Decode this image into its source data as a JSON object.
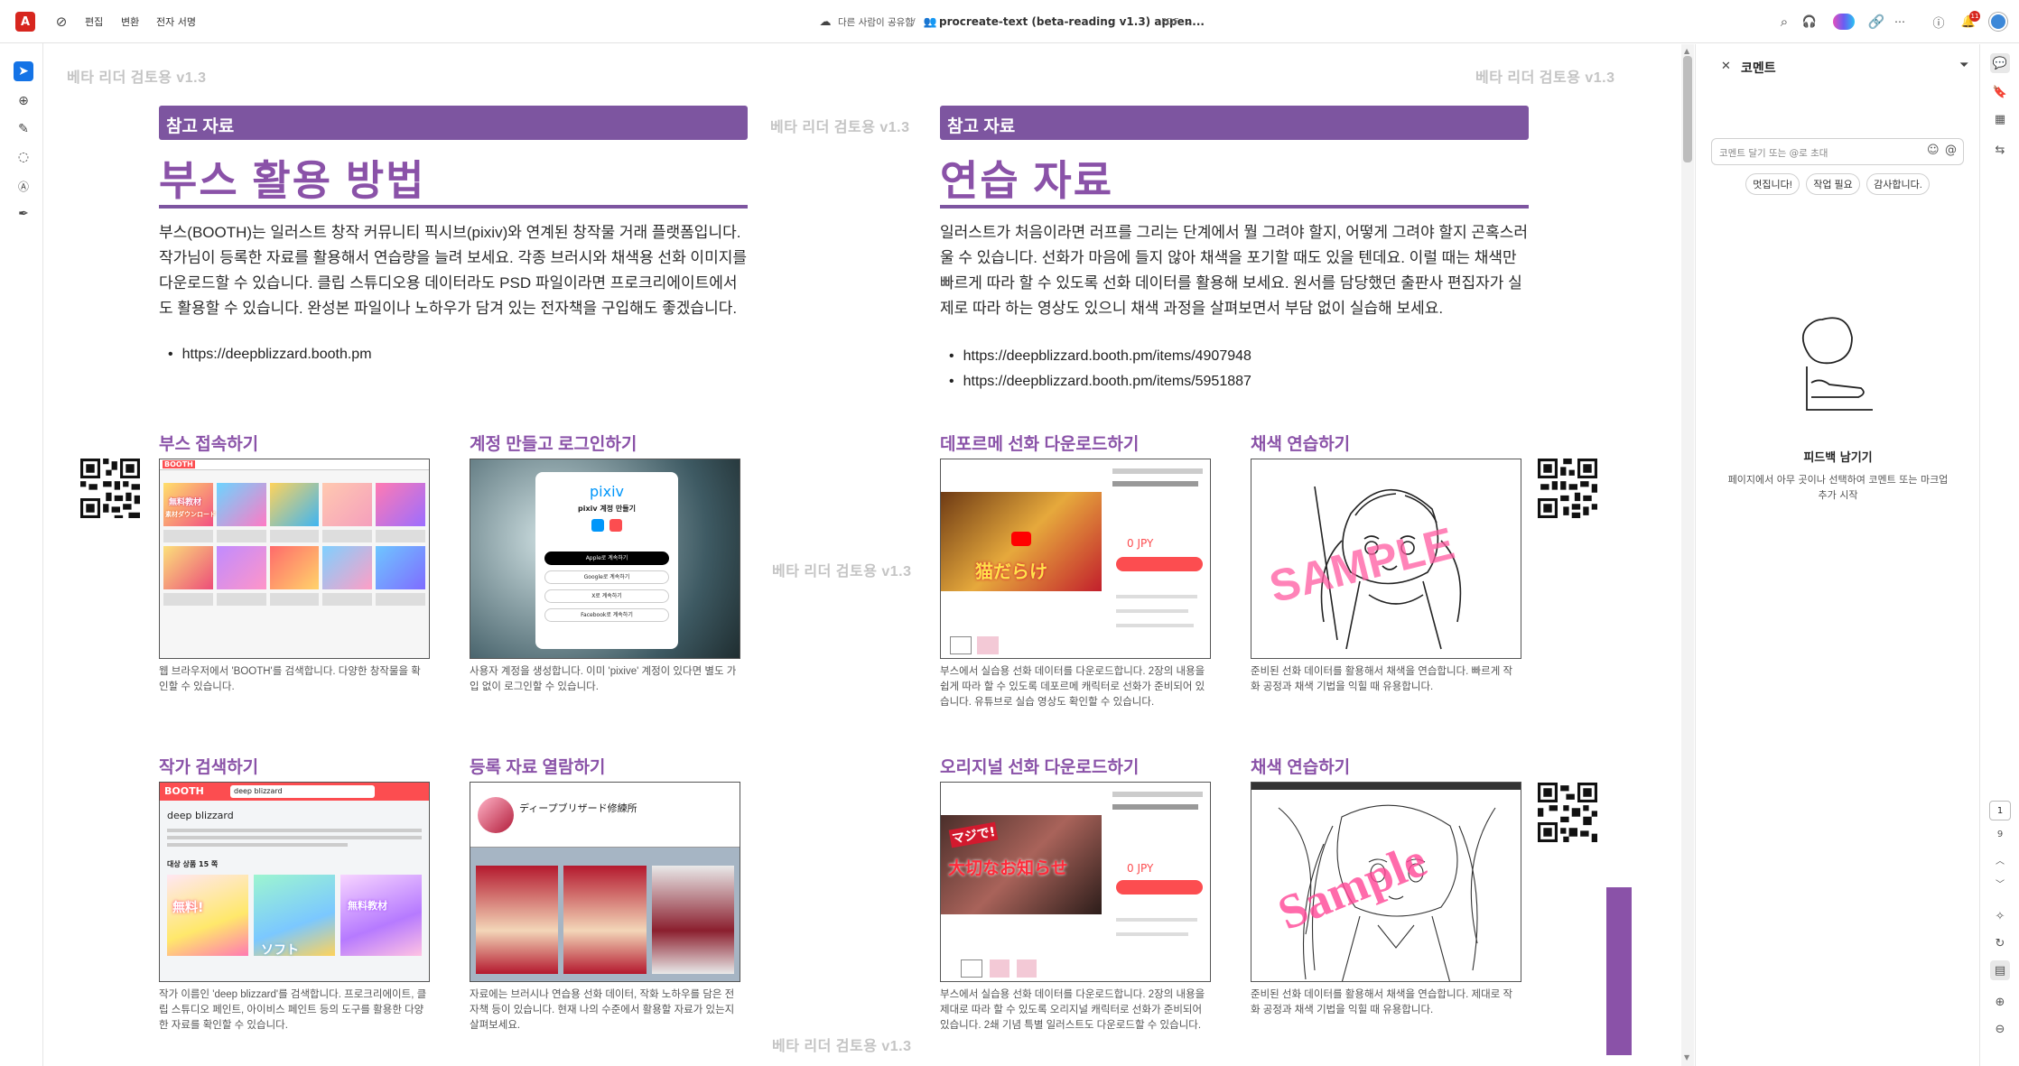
{
  "topbar": {
    "logo": "A",
    "menu": [
      "편집",
      "변환",
      "전자 서명"
    ],
    "share_status": "다른 사람이 공유함",
    "separator": "/",
    "doc_title": "procreate-text (beta-reading v1.3) appen...",
    "doc_type": "PDF",
    "notification_count": "11"
  },
  "page": {
    "watermark": "베타 리더 검토용 v1.3",
    "left": {
      "band": "참고 자료",
      "heading": "부스 활용 방법",
      "body": "부스(BOOTH)는 일러스트 창작 커뮤니티 픽시브(pixiv)와 연계된 창작물 거래 플랫폼입니다. 작가님이 등록한 자료를 활용해서 연습량을 늘려 보세요. 각종 브러시와 채색용 선화 이미지를 다운로드할 수 있습니다. 클립 스튜디오용 데이터라도 PSD 파일이라면 프로크리에이트에서도 활용할 수 있습니다. 완성본 파일이나 노하우가 담겨 있는 전자책을 구입해도 좋겠습니다.",
      "links": [
        "https://deepblizzard.booth.pm"
      ],
      "sections": [
        {
          "title": "부스 접속하기",
          "caption": "웹 브라우저에서 'BOOTH'를 검색합니다. 다양한 창작물을 확인할 수 있습니다."
        },
        {
          "title": "계정 만들고 로그인하기",
          "caption": "사용자 계정을 생성합니다. 이미 'pixive' 계정이 있다면 별도 가입 없이 로그인할 수 있습니다."
        },
        {
          "title": "작가 검색하기",
          "caption": "작가 이름인 'deep blizzard'를 검색합니다. 프로크리에이트, 클립 스튜디오 페인트, 아이비스 페인트 등의 도구를 활용한 다양한 자료를 확인할 수 있습니다."
        },
        {
          "title": "등록 자료 열람하기",
          "caption": "자료에는 브러시나 연습용 선화 데이터, 작화 노하우를 담은 전자책 등이 있습니다. 현재 나의 수준에서 활용할 자료가 있는지 살펴보세요."
        }
      ]
    },
    "right": {
      "band": "참고 자료",
      "heading": "연습 자료",
      "body": "일러스트가 처음이라면 러프를 그리는 단계에서 뭘 그려야 할지, 어떻게 그려야 할지 곤혹스러울 수 있습니다. 선화가 마음에 들지 않아 채색을 포기할 때도 있을 텐데요. 이럴 때는 채색만 빠르게 따라 할 수 있도록 선화 데이터를 활용해 보세요. 원서를 담당했던 출판사 편집자가 실제로 따라 하는 영상도 있으니 채색 과정을 살펴보면서 부담 없이 실습해 보세요.",
      "links": [
        "https://deepblizzard.booth.pm/items/4907948",
        "https://deepblizzard.booth.pm/items/5951887"
      ],
      "sections": [
        {
          "title": "데포르메 선화 다운로드하기",
          "caption": "부스에서 실습용 선화 데이터를 다운로드합니다. 2장의 내용을 쉽게 따라 할 수 있도록 데포르메 캐릭터로 선화가 준비되어 있습니다. 유튜브로 실습 영상도 확인할 수 있습니다."
        },
        {
          "title": "채색 연습하기",
          "caption": "준비된 선화 데이터를 활용해서 채색을 연습합니다. 빠르게 작화 공정과 채색 기법을 익힐 때 유용합니다."
        },
        {
          "title": "오리지널 선화 다운로드하기",
          "caption": "부스에서 실습용 선화 데이터를 다운로드합니다. 2장의 내용을 제대로 따라 할 수 있도록 오리지널 캐릭터로 선화가 준비되어 있습니다. 2쇄 기념 특별 일러스트도 다운로드할 수 있습니다."
        },
        {
          "title": "채색 연습하기",
          "caption": "준비된 선화 데이터를 활용해서 채색을 연습합니다. 제대로 작화 공정과 채색 기법을 익힐 때 유용합니다."
        }
      ]
    },
    "thumbs": {
      "booth_tab": "BOOTH",
      "booth_search": "deep blizzard",
      "booth_user": "deep blizzard",
      "booth_count": "대상 상품 15 쪽",
      "pixiv_logo": "pixiv",
      "pixiv_title": "pixiv 계정 만들기",
      "pixiv_apple": "Apple로 계속하기",
      "pixiv_google": "Google로 계속하기",
      "pixiv_x": "X로 계속하기",
      "pixiv_fb": "Facebook로 계속하기",
      "shop_name": "ディープブリザード修練所",
      "price1": "0 JPY",
      "price2": "0 JPY",
      "yt1": "猫だらけ",
      "yt2": "大切なお知らせ",
      "yt2b": "マジで!",
      "badges": [
        "無料!",
        "ソフト",
        "無料教材"
      ],
      "sample1": "SAMPLE",
      "sample2": "Sample",
      "booth_banner": "無料教材",
      "booth_banner2": "素材ダウンロード"
    }
  },
  "panel": {
    "title": "코멘트",
    "input_placeholder": "코멘트 달기 또는 @로 초대",
    "chips": [
      "멋집니다!",
      "작업 필요",
      "감사합니다."
    ],
    "empty_title": "피드백 남기기",
    "empty_body": "페이지에서 아무 곳이나 선택하여 코멘트 또는 마크업 추가 시작"
  },
  "nav": {
    "page_current": "1",
    "page_total": "9"
  },
  "colors": {
    "accent": "#7d55a0",
    "heading": "#8a52a8",
    "brand_red": "#d7261e",
    "link_blue": "#1473e6"
  }
}
